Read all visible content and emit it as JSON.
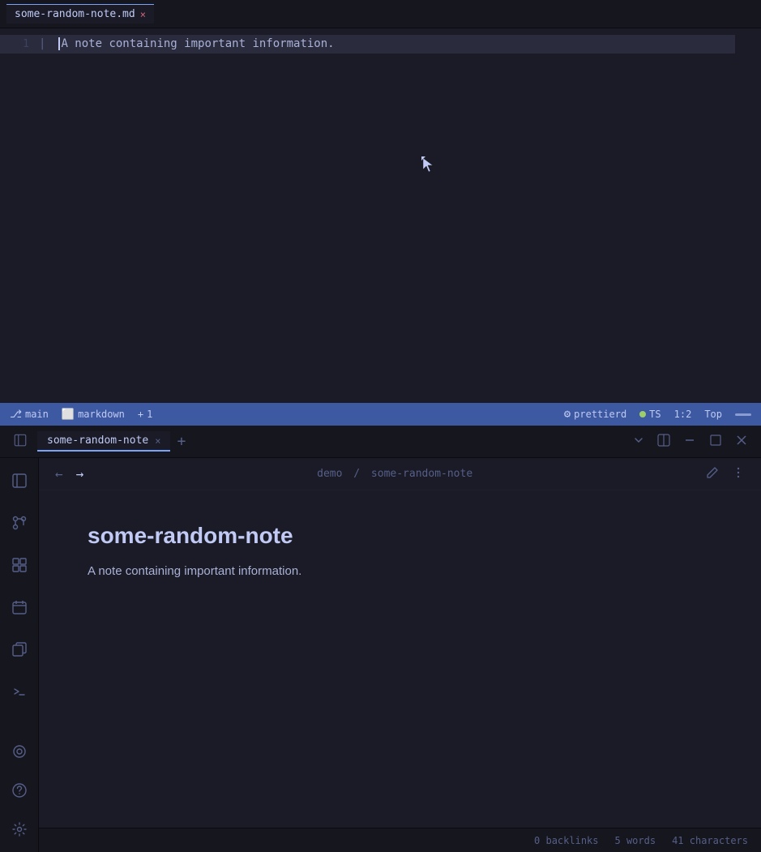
{
  "editor": {
    "tab": {
      "filename": "some-random-note.md",
      "close_label": "×"
    },
    "line1": {
      "number": "1",
      "content": "A note containing important information."
    },
    "status": {
      "branch_icon": "⎇",
      "branch": "main",
      "language_icon": "⬜",
      "language": "markdown",
      "plus_icon": "+",
      "diff_count": "1",
      "prettier": "prettierd",
      "ts_label": "TS",
      "position": "1:2",
      "scroll": "Top"
    }
  },
  "preview": {
    "tabs": [
      {
        "label": "some-random-note",
        "active": true
      }
    ],
    "add_tab_label": "+",
    "nav": {
      "back_label": "←",
      "forward_label": "→",
      "breadcrumb_parts": [
        "demo",
        "some-random-note"
      ],
      "breadcrumb_sep": "/"
    },
    "content": {
      "title": "some-random-note",
      "body": "A note containing important information."
    },
    "status_bar": {
      "backlinks": "0 backlinks",
      "words": "5 words",
      "characters": "41 characters"
    }
  },
  "sidebar": {
    "icons": [
      {
        "name": "panel-icon",
        "symbol": "⊞"
      },
      {
        "name": "git-icon",
        "symbol": "⎇"
      },
      {
        "name": "extensions-icon",
        "symbol": "⊞"
      },
      {
        "name": "calendar-icon",
        "symbol": "📅"
      },
      {
        "name": "copy-icon",
        "symbol": "⧉"
      },
      {
        "name": "terminal-icon",
        "symbol": ">_"
      }
    ],
    "bottom_icons": [
      {
        "name": "puzzle-icon",
        "symbol": "⚙"
      },
      {
        "name": "help-icon",
        "symbol": "?"
      },
      {
        "name": "settings-icon",
        "symbol": "⚙"
      }
    ]
  }
}
